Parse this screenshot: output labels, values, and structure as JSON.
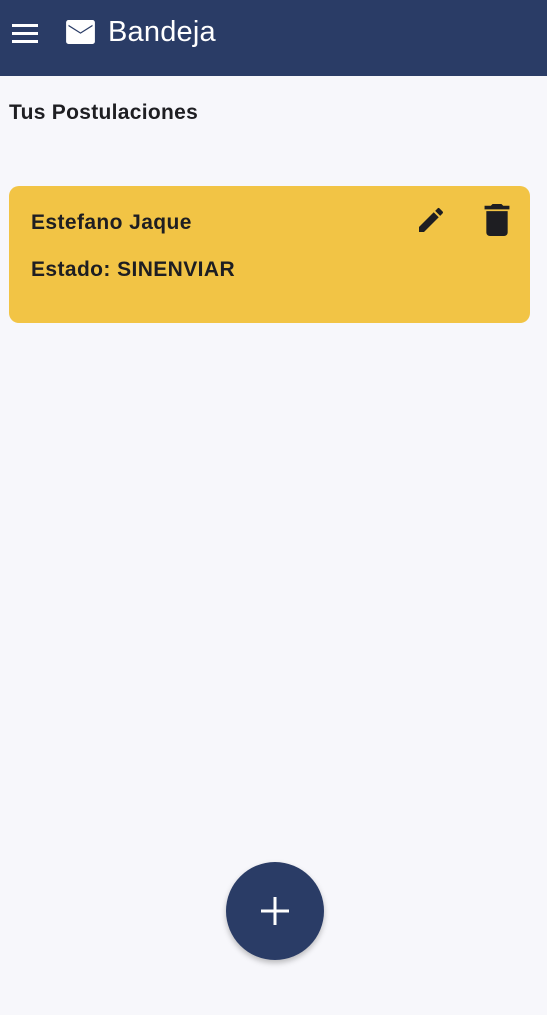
{
  "appbar": {
    "title": "Bandeja",
    "menu_icon": "hamburger-menu-icon",
    "title_icon": "mail-icon",
    "background_color": "#2A3C66"
  },
  "main": {
    "section_title": "Tus Postulaciones",
    "cards": [
      {
        "name": "Estefano Jaque",
        "status_label": "Estado:",
        "status_value": "SINENVIAR",
        "edit_icon": "pencil-icon",
        "delete_icon": "trash-icon",
        "background_color": "#F2C445"
      }
    ]
  },
  "fab": {
    "icon": "plus-icon",
    "background_color": "#2A3C66"
  }
}
